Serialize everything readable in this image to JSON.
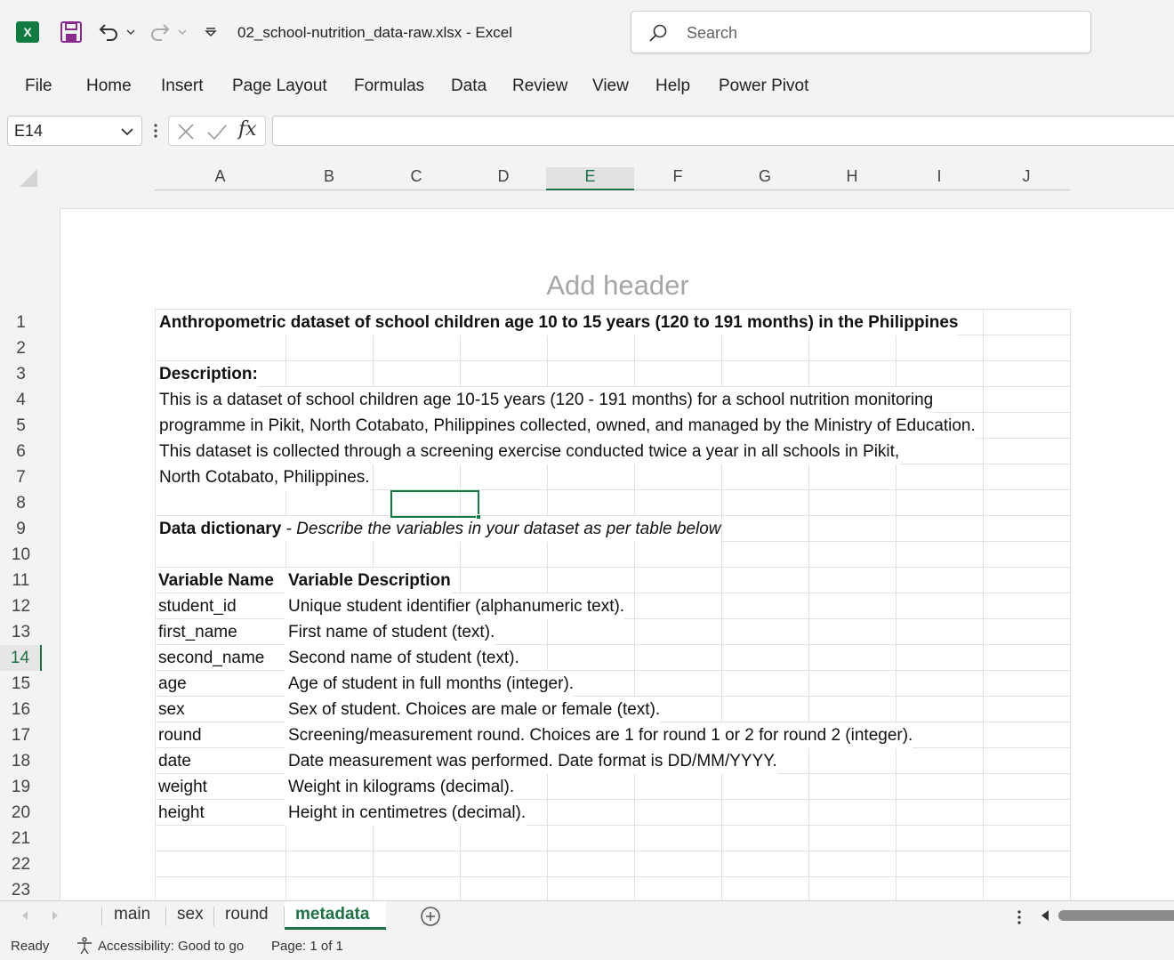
{
  "titlebar": {
    "app_icon_letter": "X",
    "doc_title": "02_school-nutrition_data-raw.xlsx  -  Excel",
    "search_placeholder": "Search"
  },
  "ribbon": {
    "tabs": [
      "File",
      "Home",
      "Insert",
      "Page Layout",
      "Formulas",
      "Data",
      "Review",
      "View",
      "Help",
      "Power Pivot"
    ]
  },
  "formula_bar": {
    "name_box": "E14",
    "fx_label": "fx",
    "formula": ""
  },
  "sheet": {
    "columns": [
      "A",
      "B",
      "C",
      "D",
      "E",
      "F",
      "G",
      "H",
      "I",
      "J"
    ],
    "active_column": "E",
    "active_row": 14,
    "header_placeholder": "Add header",
    "rows": [
      "1",
      "2",
      "3",
      "4",
      "5",
      "6",
      "7",
      "8",
      "9",
      "10",
      "11",
      "12",
      "13",
      "14",
      "15",
      "16",
      "17",
      "18",
      "19",
      "20",
      "21",
      "22",
      "23"
    ],
    "title": "Anthropometric dataset of school children age 10 to 15 years (120 to 191 months) in the Philippines",
    "description_label": "Description:",
    "description_lines": [
      "This is a dataset of school children age 10-15 years (120 - 191 months) for a school nutrition monitoring",
      "programme in Pikit, North Cotabato, Philippines collected, owned, and managed by the Ministry of Education.",
      "This dataset is collected through a screening exercise conducted twice a year in all schools in Pikit,",
      "North Cotabato, Philippines."
    ],
    "dictionary_label": "Data dictionary",
    "dictionary_note": " - Describe the variables in your dataset as per table below",
    "table_headers": [
      "Variable Name",
      "Variable Description"
    ],
    "variables": [
      {
        "name": "student_id",
        "description": "Unique student identifier (alphanumeric text)."
      },
      {
        "name": "first_name",
        "description": "First name of student (text)."
      },
      {
        "name": "second_name",
        "description": "Second name of student (text)."
      },
      {
        "name": "age",
        "description": "Age of student in full months (integer)."
      },
      {
        "name": "sex",
        "description": "Sex of student. Choices are male or female (text)."
      },
      {
        "name": "round",
        "description": "Screening/measurement round. Choices are 1 for round 1 or 2 for round 2 (integer)."
      },
      {
        "name": "date",
        "description": "Date measurement was performed. Date format is DD/MM/YYYY."
      },
      {
        "name": "weight",
        "description": "Weight in kilograms (decimal)."
      },
      {
        "name": "height",
        "description": "Height in centimetres (decimal)."
      }
    ]
  },
  "sheet_tabs": {
    "tabs": [
      "main",
      "sex",
      "round",
      "metadata"
    ],
    "active": "metadata"
  },
  "status_bar": {
    "ready": "Ready",
    "accessibility": "Accessibility: Good to go",
    "page": "Page: 1 of 1"
  },
  "colors": {
    "excel_green": "#107c41",
    "active_header_green": "#1e7145",
    "grid_line": "#e1e1e1"
  }
}
